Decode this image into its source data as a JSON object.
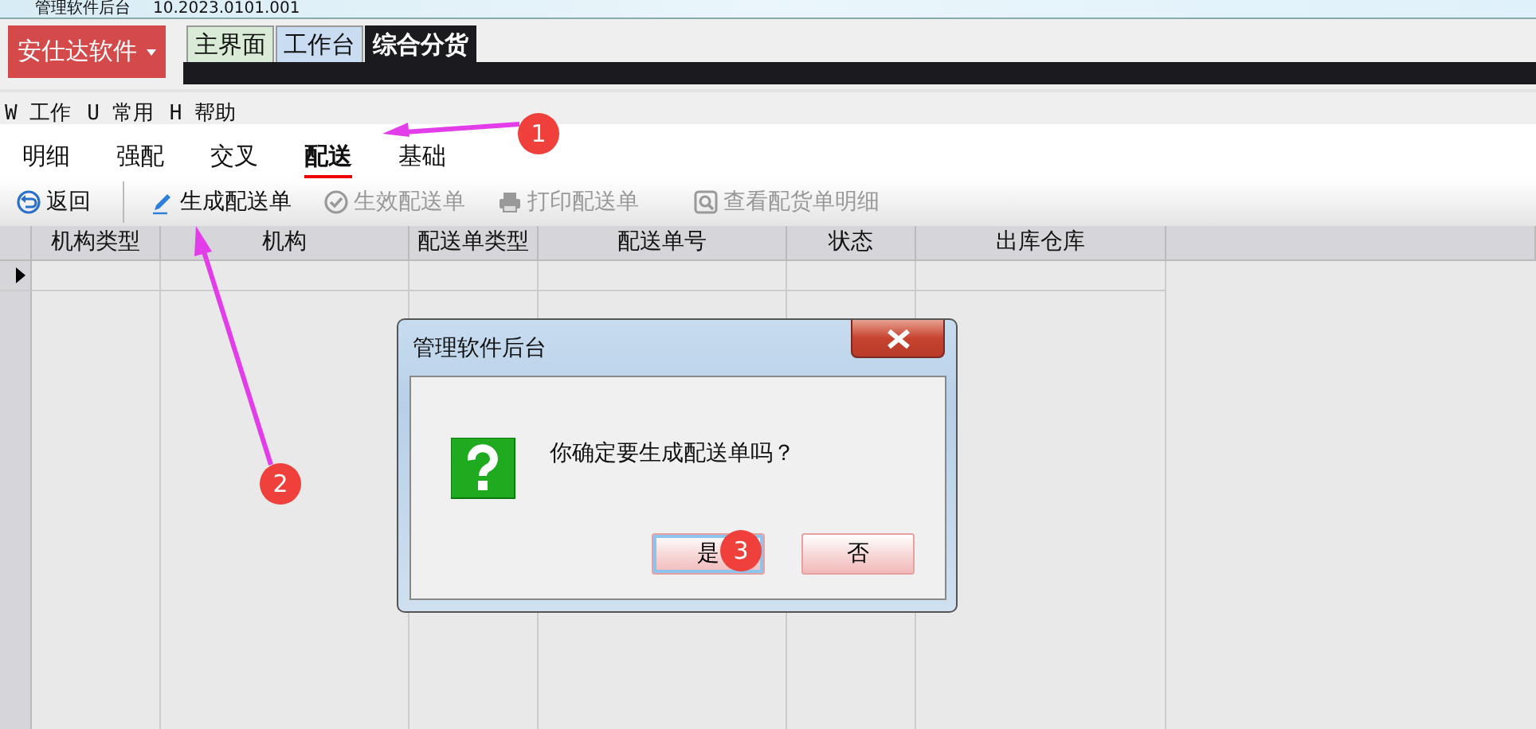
{
  "window": {
    "title": "管理软件后台",
    "version": "10.2023.0101.001"
  },
  "app_button": {
    "label": "安仕达软件"
  },
  "top_tabs": [
    {
      "label": "主界面",
      "selected": false,
      "color": "#d9ead6"
    },
    {
      "label": "工作台",
      "selected": false,
      "color": "#c9dcf2"
    },
    {
      "label": "综合分货",
      "selected": true,
      "color": "#1b1a1f"
    }
  ],
  "menu": [
    {
      "key": "W",
      "label": "工作"
    },
    {
      "key": "U",
      "label": "常用"
    },
    {
      "key": "H",
      "label": "帮助"
    }
  ],
  "sub_tabs": [
    {
      "label": "明细",
      "selected": false
    },
    {
      "label": "强配",
      "selected": false
    },
    {
      "label": "交叉",
      "selected": false
    },
    {
      "label": "配送",
      "selected": true
    },
    {
      "label": "基础",
      "selected": false
    }
  ],
  "toolbar": [
    {
      "label": "返回",
      "kind": "back",
      "disabled": false
    },
    {
      "label": "生成配送单",
      "kind": "pencil",
      "disabled": false
    },
    {
      "label": "生效配送单",
      "kind": "check",
      "disabled": true
    },
    {
      "label": "打印配送单",
      "kind": "printer",
      "disabled": true
    },
    {
      "label": "查看配货单明细",
      "kind": "magnifier",
      "disabled": true
    }
  ],
  "table": {
    "columns": [
      "机构类型",
      "机构",
      "配送单类型",
      "配送单号",
      "状态",
      "出库仓库"
    ],
    "rows": [
      {
        "selected": true
      }
    ]
  },
  "dialog": {
    "title": "管理软件后台",
    "message": "你确定要生成配送单吗？",
    "buttons": [
      {
        "label": "是",
        "focused": true
      },
      {
        "label": "否",
        "focused": false
      }
    ]
  },
  "annotations": [
    {
      "number": "1"
    },
    {
      "number": "2"
    },
    {
      "number": "3"
    }
  ]
}
